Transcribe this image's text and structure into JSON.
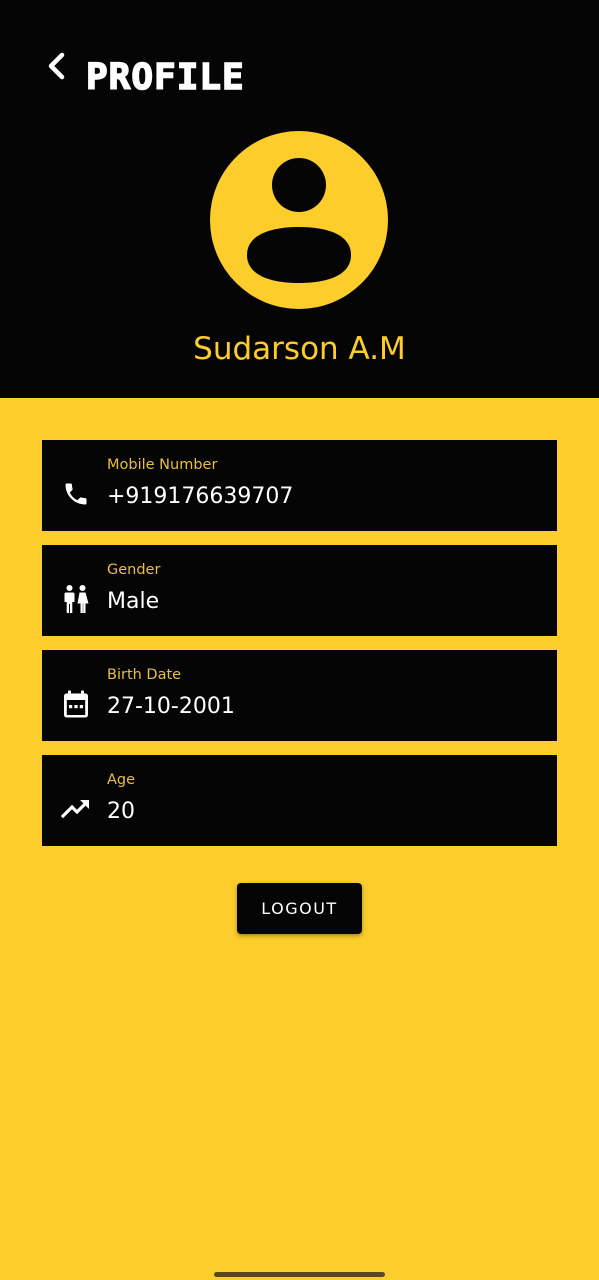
{
  "header": {
    "title": "PROFILE",
    "back_icon": "chevron-left-icon"
  },
  "profile": {
    "avatar_icon": "account-circle-icon",
    "name": "Sudarson A.M"
  },
  "fields": [
    {
      "icon": "phone-icon",
      "label": "Mobile Number",
      "value": "+919176639707"
    },
    {
      "icon": "gender-icon",
      "label": "Gender",
      "value": "Male"
    },
    {
      "icon": "calendar-icon",
      "label": "Birth Date",
      "value": "27-10-2001"
    },
    {
      "icon": "trending-up-icon",
      "label": "Age",
      "value": "20"
    }
  ],
  "actions": {
    "logout_label": "LOGOUT"
  },
  "colors": {
    "accent": "#FDCD2C",
    "dark": "#050505",
    "label": "#E9BE44",
    "text": "#FFFFFF"
  }
}
